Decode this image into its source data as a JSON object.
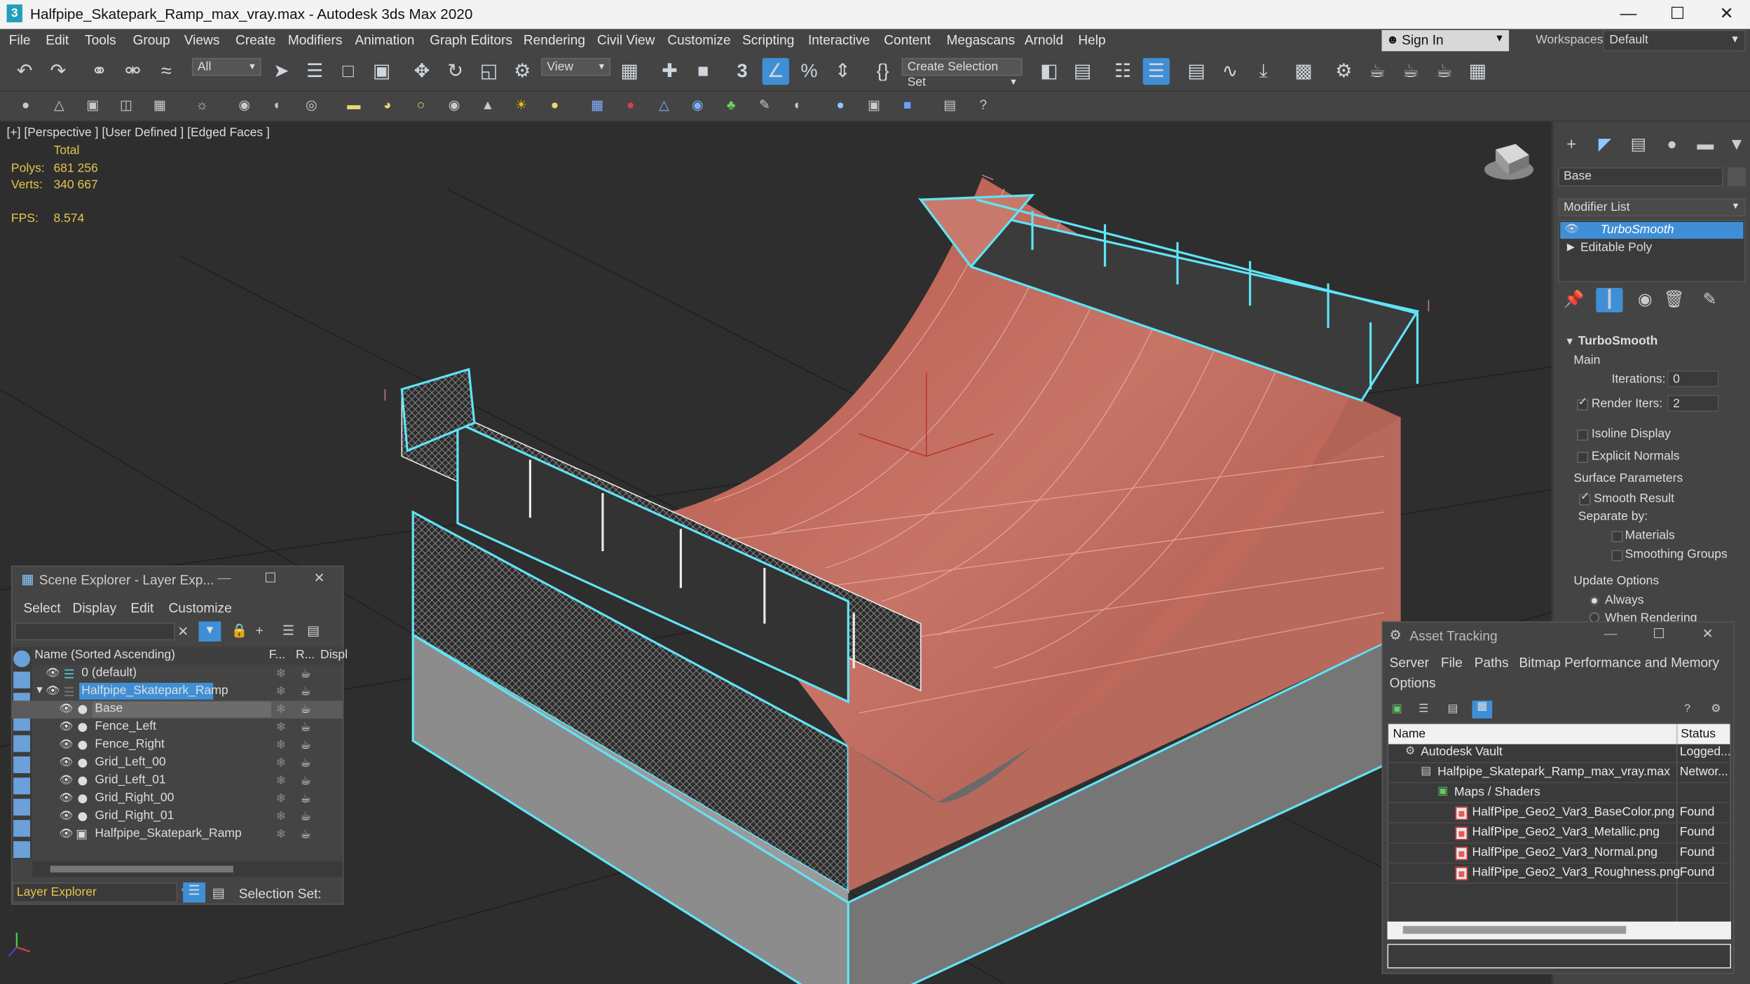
{
  "app": {
    "title": "Halfpipe_Skatepark_Ramp_max_vray.max - Autodesk 3ds Max 2020",
    "logo": "3"
  },
  "menu": [
    "File",
    "Edit",
    "Tools",
    "Group",
    "Views",
    "Create",
    "Modifiers",
    "Animation",
    "Graph Editors",
    "Rendering",
    "Civil View",
    "Customize",
    "Scripting",
    "Interactive",
    "Content",
    "Megascans",
    "Arnold",
    "Help"
  ],
  "account": {
    "signin": "Sign In",
    "workspaces_label": "Workspaces:",
    "workspace": "Default"
  },
  "toolbar": {
    "filter": "All",
    "refcoord": "View",
    "selection_set": "Create Selection Set",
    "snap_label": "3"
  },
  "viewport": {
    "label": "[+] [Perspective ] [User Defined ] [Edged Faces ]",
    "stats_header": "Total",
    "polys_label": "Polys:",
    "polys": "681 256",
    "verts_label": "Verts:",
    "verts": "340 667",
    "fps_label": "FPS:",
    "fps": "8.574"
  },
  "command_panel": {
    "object_name": "Base",
    "modifier_list": "Modifier List",
    "stack": [
      "TurboSmooth",
      "Editable Poly"
    ],
    "rollout_title": "TurboSmooth",
    "main": "Main",
    "iterations_label": "Iterations:",
    "iterations": "0",
    "render_iters_label": "Render Iters:",
    "render_iters": "2",
    "isoline": "Isoline Display",
    "explicit_normals": "Explicit Normals",
    "surface_params": "Surface Parameters",
    "smooth_result": "Smooth Result",
    "separate_by": "Separate by:",
    "materials": "Materials",
    "smoothing_groups": "Smoothing Groups",
    "update_options": "Update Options",
    "always": "Always",
    "when_rendering": "When Rendering"
  },
  "scene_explorer": {
    "title": "Scene Explorer - Layer Exp...",
    "menu": [
      "Select",
      "Display",
      "Edit",
      "Customize"
    ],
    "columns": [
      "Name (Sorted Ascending)",
      "F...",
      "R...",
      "Displ"
    ],
    "rows": [
      "0 (default)",
      "Halfpipe_Skatepark_Ramp",
      "Base",
      "Fence_Left",
      "Fence_Right",
      "Grid_Left_00",
      "Grid_Left_01",
      "Grid_Right_00",
      "Grid_Right_01",
      "Halfpipe_Skatepark_Ramp"
    ],
    "footer_mode": "Layer Explorer",
    "selection_set_label": "Selection Set:"
  },
  "asset_tracking": {
    "title": "Asset Tracking",
    "menu": [
      "Server",
      "File",
      "Paths",
      "Bitmap Performance and Memory",
      "Options"
    ],
    "columns": [
      "Name",
      "Status"
    ],
    "rows": [
      {
        "name": "Autodesk Vault",
        "status": "Logged..."
      },
      {
        "name": "Halfpipe_Skatepark_Ramp_max_vray.max",
        "status": "Networ..."
      },
      {
        "name": "Maps / Shaders",
        "status": ""
      },
      {
        "name": "HalfPipe_Geo2_Var3_BaseColor.png",
        "status": "Found"
      },
      {
        "name": "HalfPipe_Geo2_Var3_Metallic.png",
        "status": "Found"
      },
      {
        "name": "HalfPipe_Geo2_Var3_Normal.png",
        "status": "Found"
      },
      {
        "name": "HalfPipe_Geo2_Var3_Roughness.png",
        "status": "Found"
      }
    ]
  },
  "colors": {
    "accent": "#3f8fd6",
    "selection_highlight": "#5fe4f7",
    "stats": "#e5c44a",
    "ramp": "#c7685a"
  }
}
